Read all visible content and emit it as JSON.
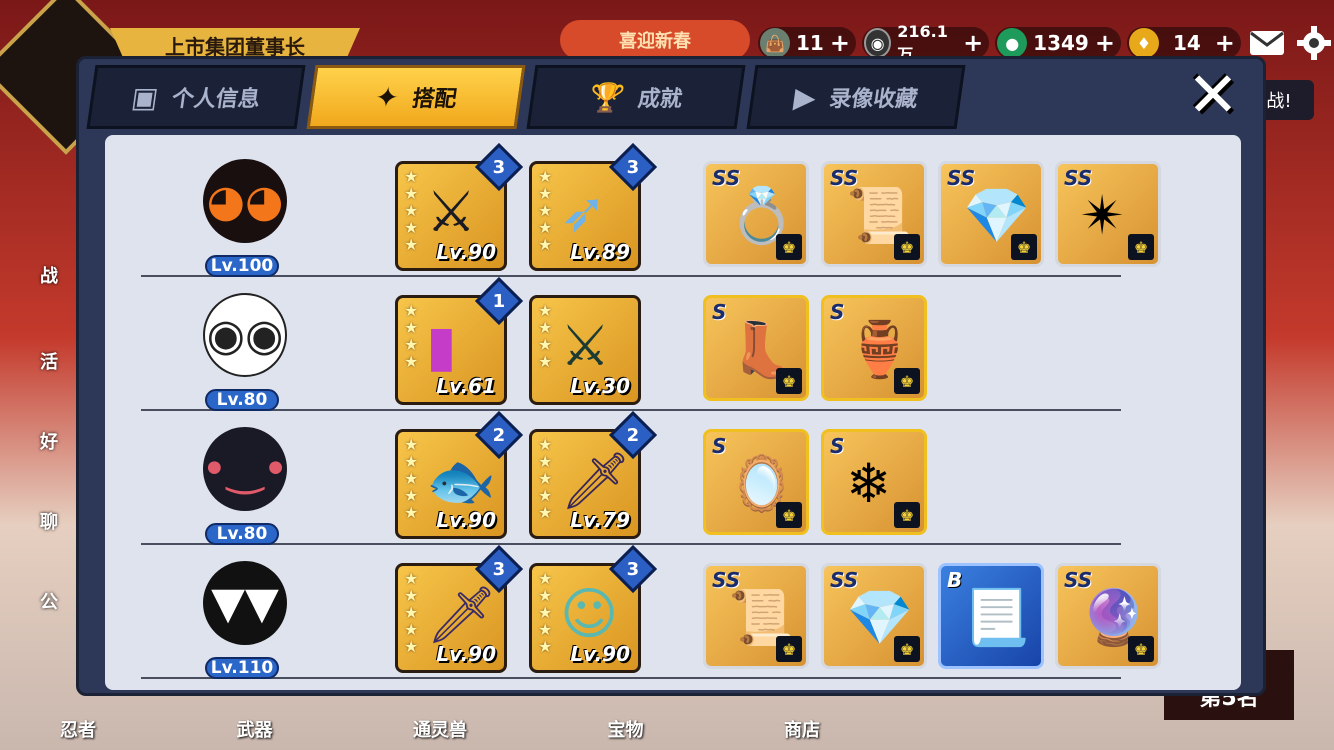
{
  "background": {
    "title_banner": "上市集团董事长",
    "event_label": "喜迎新春",
    "right_button": "战!",
    "rank_label": "第5名",
    "side_labels": [
      "战",
      "活",
      "好",
      "聊",
      "公"
    ],
    "bottom_nav": [
      "忍者",
      "武器",
      "通灵兽",
      "宝物",
      "商店"
    ]
  },
  "resources": [
    {
      "icon": "scroll-bag-icon",
      "value": "11",
      "color": "#6b7f70"
    },
    {
      "icon": "coin-icon",
      "value": "216.1万",
      "color": "#333333"
    },
    {
      "icon": "jade-icon",
      "value": "1349",
      "color": "#1e9a5a"
    },
    {
      "icon": "gourd-icon",
      "value": "14",
      "color": "#e7a81a"
    }
  ],
  "tabs": [
    {
      "label": "个人信息",
      "icon": "profile-card-icon",
      "active": false
    },
    {
      "label": "搭配",
      "icon": "shuriken-icon",
      "active": true
    },
    {
      "label": "成就",
      "icon": "trophy-icon",
      "active": false
    },
    {
      "label": "录像收藏",
      "icon": "play-icon",
      "active": false
    }
  ],
  "rows": [
    {
      "avatar": "red-ninja",
      "level": "Lv.100",
      "weapons": [
        {
          "stars": 5,
          "level": "Lv.90",
          "rank": "3"
        },
        {
          "stars": 5,
          "level": "Lv.89",
          "rank": "3"
        }
      ],
      "items": [
        {
          "grade": "SS",
          "name": "ring"
        },
        {
          "grade": "SS",
          "name": "scroll"
        },
        {
          "grade": "SS",
          "name": "crystal"
        },
        {
          "grade": "SS",
          "name": "shuriken"
        }
      ]
    },
    {
      "avatar": "panda",
      "level": "Lv.80",
      "weapons": [
        {
          "stars": 4,
          "level": "Lv.61",
          "rank": "1"
        },
        {
          "stars": 4,
          "level": "Lv.30",
          "rank": ""
        }
      ],
      "items": [
        {
          "grade": "S",
          "name": "boot"
        },
        {
          "grade": "S",
          "name": "gourd"
        }
      ]
    },
    {
      "avatar": "blue-girl",
      "level": "Lv.80",
      "weapons": [
        {
          "stars": 5,
          "level": "Lv.90",
          "rank": "2"
        },
        {
          "stars": 5,
          "level": "Lv.79",
          "rank": "2"
        }
      ],
      "items": [
        {
          "grade": "S",
          "name": "mirror"
        },
        {
          "grade": "S",
          "name": "ice-feather"
        }
      ]
    },
    {
      "avatar": "dark-spiky",
      "level": "Lv.110",
      "weapons": [
        {
          "stars": 5,
          "level": "Lv.90",
          "rank": "3"
        },
        {
          "stars": 5,
          "level": "Lv.90",
          "rank": "3"
        }
      ],
      "items": [
        {
          "grade": "SS",
          "name": "scroll"
        },
        {
          "grade": "SS",
          "name": "crystal"
        },
        {
          "grade": "B",
          "name": "parchment"
        },
        {
          "grade": "SS",
          "name": "dark-ring"
        }
      ]
    }
  ]
}
